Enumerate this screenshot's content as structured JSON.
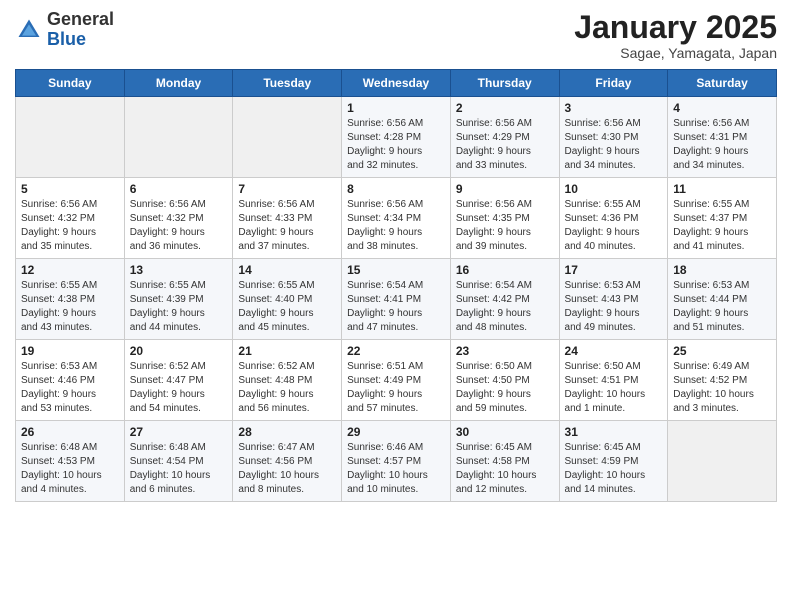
{
  "header": {
    "logo": {
      "general": "General",
      "blue": "Blue"
    },
    "title": "January 2025",
    "subtitle": "Sagae, Yamagata, Japan"
  },
  "weekdays": [
    "Sunday",
    "Monday",
    "Tuesday",
    "Wednesday",
    "Thursday",
    "Friday",
    "Saturday"
  ],
  "weeks": [
    [
      {
        "day": "",
        "info": ""
      },
      {
        "day": "",
        "info": ""
      },
      {
        "day": "",
        "info": ""
      },
      {
        "day": "1",
        "info": "Sunrise: 6:56 AM\nSunset: 4:28 PM\nDaylight: 9 hours\nand 32 minutes."
      },
      {
        "day": "2",
        "info": "Sunrise: 6:56 AM\nSunset: 4:29 PM\nDaylight: 9 hours\nand 33 minutes."
      },
      {
        "day": "3",
        "info": "Sunrise: 6:56 AM\nSunset: 4:30 PM\nDaylight: 9 hours\nand 34 minutes."
      },
      {
        "day": "4",
        "info": "Sunrise: 6:56 AM\nSunset: 4:31 PM\nDaylight: 9 hours\nand 34 minutes."
      }
    ],
    [
      {
        "day": "5",
        "info": "Sunrise: 6:56 AM\nSunset: 4:32 PM\nDaylight: 9 hours\nand 35 minutes."
      },
      {
        "day": "6",
        "info": "Sunrise: 6:56 AM\nSunset: 4:32 PM\nDaylight: 9 hours\nand 36 minutes."
      },
      {
        "day": "7",
        "info": "Sunrise: 6:56 AM\nSunset: 4:33 PM\nDaylight: 9 hours\nand 37 minutes."
      },
      {
        "day": "8",
        "info": "Sunrise: 6:56 AM\nSunset: 4:34 PM\nDaylight: 9 hours\nand 38 minutes."
      },
      {
        "day": "9",
        "info": "Sunrise: 6:56 AM\nSunset: 4:35 PM\nDaylight: 9 hours\nand 39 minutes."
      },
      {
        "day": "10",
        "info": "Sunrise: 6:55 AM\nSunset: 4:36 PM\nDaylight: 9 hours\nand 40 minutes."
      },
      {
        "day": "11",
        "info": "Sunrise: 6:55 AM\nSunset: 4:37 PM\nDaylight: 9 hours\nand 41 minutes."
      }
    ],
    [
      {
        "day": "12",
        "info": "Sunrise: 6:55 AM\nSunset: 4:38 PM\nDaylight: 9 hours\nand 43 minutes."
      },
      {
        "day": "13",
        "info": "Sunrise: 6:55 AM\nSunset: 4:39 PM\nDaylight: 9 hours\nand 44 minutes."
      },
      {
        "day": "14",
        "info": "Sunrise: 6:55 AM\nSunset: 4:40 PM\nDaylight: 9 hours\nand 45 minutes."
      },
      {
        "day": "15",
        "info": "Sunrise: 6:54 AM\nSunset: 4:41 PM\nDaylight: 9 hours\nand 47 minutes."
      },
      {
        "day": "16",
        "info": "Sunrise: 6:54 AM\nSunset: 4:42 PM\nDaylight: 9 hours\nand 48 minutes."
      },
      {
        "day": "17",
        "info": "Sunrise: 6:53 AM\nSunset: 4:43 PM\nDaylight: 9 hours\nand 49 minutes."
      },
      {
        "day": "18",
        "info": "Sunrise: 6:53 AM\nSunset: 4:44 PM\nDaylight: 9 hours\nand 51 minutes."
      }
    ],
    [
      {
        "day": "19",
        "info": "Sunrise: 6:53 AM\nSunset: 4:46 PM\nDaylight: 9 hours\nand 53 minutes."
      },
      {
        "day": "20",
        "info": "Sunrise: 6:52 AM\nSunset: 4:47 PM\nDaylight: 9 hours\nand 54 minutes."
      },
      {
        "day": "21",
        "info": "Sunrise: 6:52 AM\nSunset: 4:48 PM\nDaylight: 9 hours\nand 56 minutes."
      },
      {
        "day": "22",
        "info": "Sunrise: 6:51 AM\nSunset: 4:49 PM\nDaylight: 9 hours\nand 57 minutes."
      },
      {
        "day": "23",
        "info": "Sunrise: 6:50 AM\nSunset: 4:50 PM\nDaylight: 9 hours\nand 59 minutes."
      },
      {
        "day": "24",
        "info": "Sunrise: 6:50 AM\nSunset: 4:51 PM\nDaylight: 10 hours\nand 1 minute."
      },
      {
        "day": "25",
        "info": "Sunrise: 6:49 AM\nSunset: 4:52 PM\nDaylight: 10 hours\nand 3 minutes."
      }
    ],
    [
      {
        "day": "26",
        "info": "Sunrise: 6:48 AM\nSunset: 4:53 PM\nDaylight: 10 hours\nand 4 minutes."
      },
      {
        "day": "27",
        "info": "Sunrise: 6:48 AM\nSunset: 4:54 PM\nDaylight: 10 hours\nand 6 minutes."
      },
      {
        "day": "28",
        "info": "Sunrise: 6:47 AM\nSunset: 4:56 PM\nDaylight: 10 hours\nand 8 minutes."
      },
      {
        "day": "29",
        "info": "Sunrise: 6:46 AM\nSunset: 4:57 PM\nDaylight: 10 hours\nand 10 minutes."
      },
      {
        "day": "30",
        "info": "Sunrise: 6:45 AM\nSunset: 4:58 PM\nDaylight: 10 hours\nand 12 minutes."
      },
      {
        "day": "31",
        "info": "Sunrise: 6:45 AM\nSunset: 4:59 PM\nDaylight: 10 hours\nand 14 minutes."
      },
      {
        "day": "",
        "info": ""
      }
    ]
  ]
}
